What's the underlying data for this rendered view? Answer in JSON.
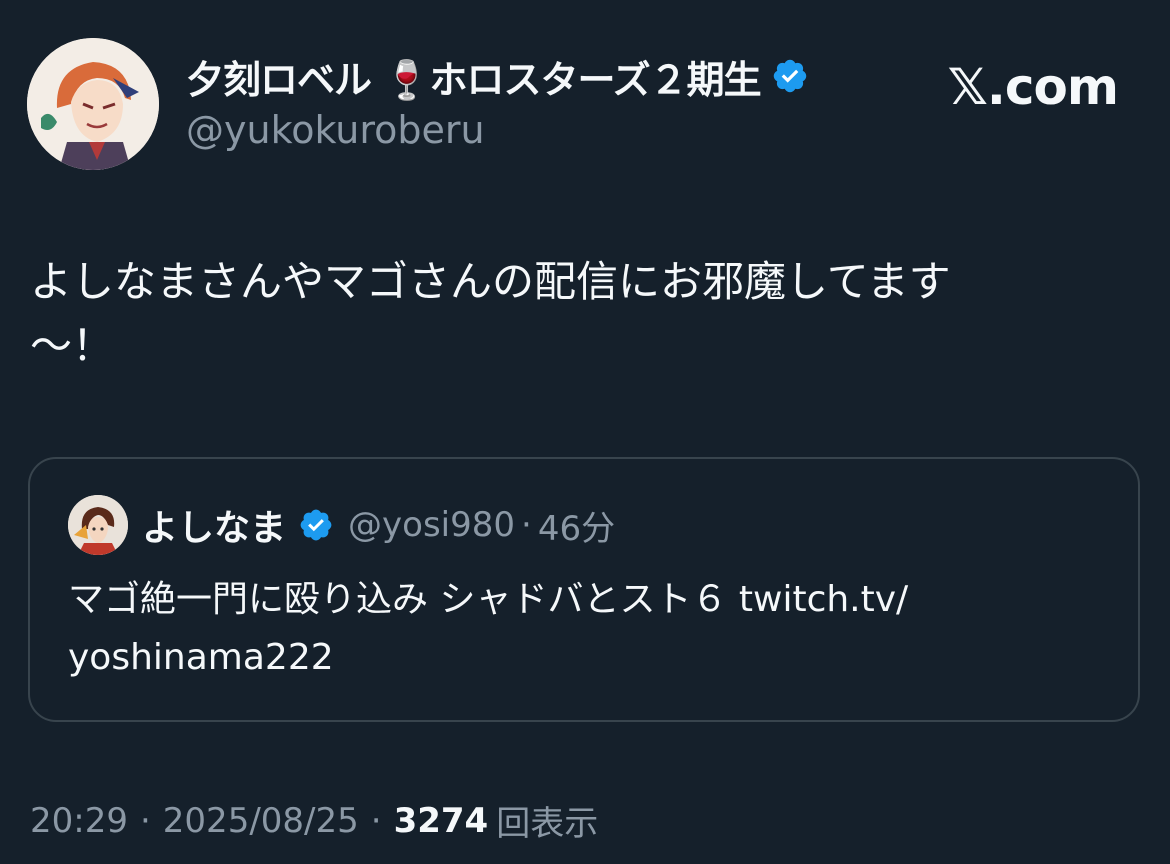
{
  "tweet": {
    "author": {
      "display_name": "夕刻ロベル 🍷ホロスターズ２期生",
      "handle": "@yukokuroberu",
      "verified": true
    },
    "brand": "𝕏.com",
    "text_line1": "よしなまさんやマゴさんの配信にお邪魔してます",
    "text_line2": "〜！",
    "quote": {
      "display_name": "よしなま",
      "handle": "@yosi980",
      "separator": "·",
      "time": "46分",
      "text_line1": "マゴ絶一門に殴り込み シャドバとスト６ twitch.tv/",
      "text_line2": "yoshinama222"
    },
    "meta": {
      "time": "20:29",
      "date": "2025/08/25",
      "separator": "·",
      "views_count": "3274",
      "views_label": "回表示"
    }
  },
  "colors": {
    "background": "#15202b",
    "verified": "#1d9bf0",
    "secondary_text": "#8b98a5",
    "border": "#38444d"
  },
  "icons": {
    "verified": "verified-badge-icon",
    "avatar": "avatar",
    "quoted_avatar": "avatar"
  }
}
